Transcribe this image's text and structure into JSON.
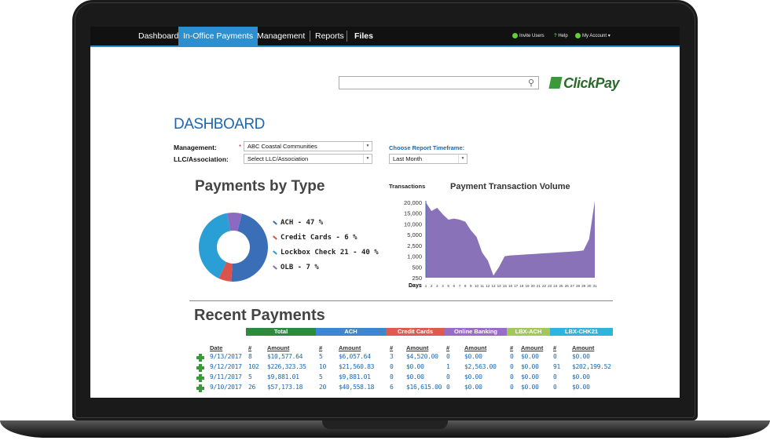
{
  "nav": {
    "items": [
      {
        "label": "Dashboard"
      },
      {
        "label": "In-Office Payments"
      },
      {
        "label": "Management"
      },
      {
        "label": "Reports"
      },
      {
        "label": "Files"
      }
    ],
    "right": {
      "invite": "Invite Users",
      "help": "Help",
      "account": "My Account"
    }
  },
  "search": {
    "placeholder": ""
  },
  "logo": {
    "text": "ClickPay"
  },
  "page": {
    "title": "DASHBOARD"
  },
  "filters": {
    "management_label": "Management:",
    "management_value": "ABC Coastal Communities",
    "llc_label": "LLC/Association:",
    "llc_value": "Select LLC/Association",
    "timeframe_label": "Choose Report Timeframe:",
    "timeframe_value": "Last Month"
  },
  "payments_by_type": {
    "title": "Payments by Type",
    "legend": [
      {
        "label": "ACH - 47 %",
        "color": "#3a6fb8"
      },
      {
        "label": "Credit Cards - 6 %",
        "color": "#d9534f"
      },
      {
        "label": "Lockbox Check 21 - 40 %",
        "color": "#2a9fd6"
      },
      {
        "label": "OLB - 7 %",
        "color": "#8a6bbf"
      }
    ]
  },
  "volume": {
    "side_label": "Transactions",
    "title": "Payment Transaction Volume",
    "xlabel": "Days",
    "y_ticks": [
      "20,000",
      "15,000",
      "10,000",
      "5,000",
      "2,500",
      "1,000",
      "500",
      "250"
    ],
    "x_ticks": [
      "1",
      "2",
      "3",
      "4",
      "5",
      "6",
      "7",
      "8",
      "9",
      "10",
      "11",
      "12",
      "13",
      "14",
      "15",
      "16",
      "17",
      "18",
      "19",
      "20",
      "21",
      "22",
      "23",
      "24",
      "25",
      "26",
      "27",
      "28",
      "29",
      "30",
      "31"
    ]
  },
  "chart_data": [
    {
      "type": "pie",
      "title": "Payments by Type",
      "categories": [
        "ACH",
        "Credit Cards",
        "Lockbox Check 21",
        "OLB"
      ],
      "values": [
        47,
        6,
        40,
        7
      ]
    },
    {
      "type": "area",
      "title": "Payment Transaction Volume",
      "xlabel": "Days",
      "ylabel": "Transactions",
      "x": [
        1,
        2,
        3,
        4,
        5,
        6,
        7,
        8,
        9,
        10,
        11,
        12,
        13,
        14,
        15,
        16,
        17,
        18,
        19,
        20,
        21,
        22,
        23,
        24,
        25,
        26,
        27,
        28,
        29,
        30,
        31
      ],
      "values": [
        20000,
        16000,
        17500,
        14500,
        12000,
        12500,
        12000,
        11000,
        7000,
        4500,
        1500,
        800,
        300,
        500,
        1000,
        1100,
        1150,
        1200,
        1250,
        1300,
        1350,
        1400,
        1450,
        1500,
        1550,
        1600,
        1650,
        1700,
        1800,
        4000,
        22000
      ],
      "ylim": [
        250,
        20000
      ],
      "color": "#8a72b8"
    }
  ],
  "recent": {
    "title": "Recent Payments",
    "bands": [
      {
        "label": "Total",
        "color": "#2e8b3e"
      },
      {
        "label": "ACH",
        "color": "#3f86d0"
      },
      {
        "label": "Credit Cards",
        "color": "#e05a4f"
      },
      {
        "label": "Online Banking",
        "color": "#9b6cc7"
      },
      {
        "label": "LBX-ACH",
        "color": "#a3c85a"
      },
      {
        "label": "LBX-CHK21",
        "color": "#2fb4e0"
      }
    ],
    "headers": [
      "Date",
      "#",
      "Amount",
      "#",
      "Amount",
      "#",
      "Amount",
      "#",
      "Amount",
      "#",
      "Amount",
      "#",
      "Amount"
    ],
    "rows": [
      [
        "9/13/2017",
        "8",
        "$10,577.64",
        "5",
        "$6,057.64",
        "3",
        "$4,520.00",
        "0",
        "$0.00",
        "0",
        "$0.00",
        "0",
        "$0.00"
      ],
      [
        "9/12/2017",
        "102",
        "$226,323.35",
        "10",
        "$21,560.83",
        "0",
        "$0.00",
        "1",
        "$2,563.00",
        "0",
        "$0.00",
        "91",
        "$202,199.52"
      ],
      [
        "9/11/2017",
        "5",
        "$9,881.01",
        "5",
        "$9,881.01",
        "0",
        "$0.00",
        "0",
        "$0.00",
        "0",
        "$0.00",
        "0",
        "$0.00"
      ],
      [
        "9/10/2017",
        "26",
        "$57,173.18",
        "20",
        "$40,558.18",
        "6",
        "$16,615.00",
        "0",
        "$0.00",
        "0",
        "$0.00",
        "0",
        "$0.00"
      ]
    ]
  }
}
